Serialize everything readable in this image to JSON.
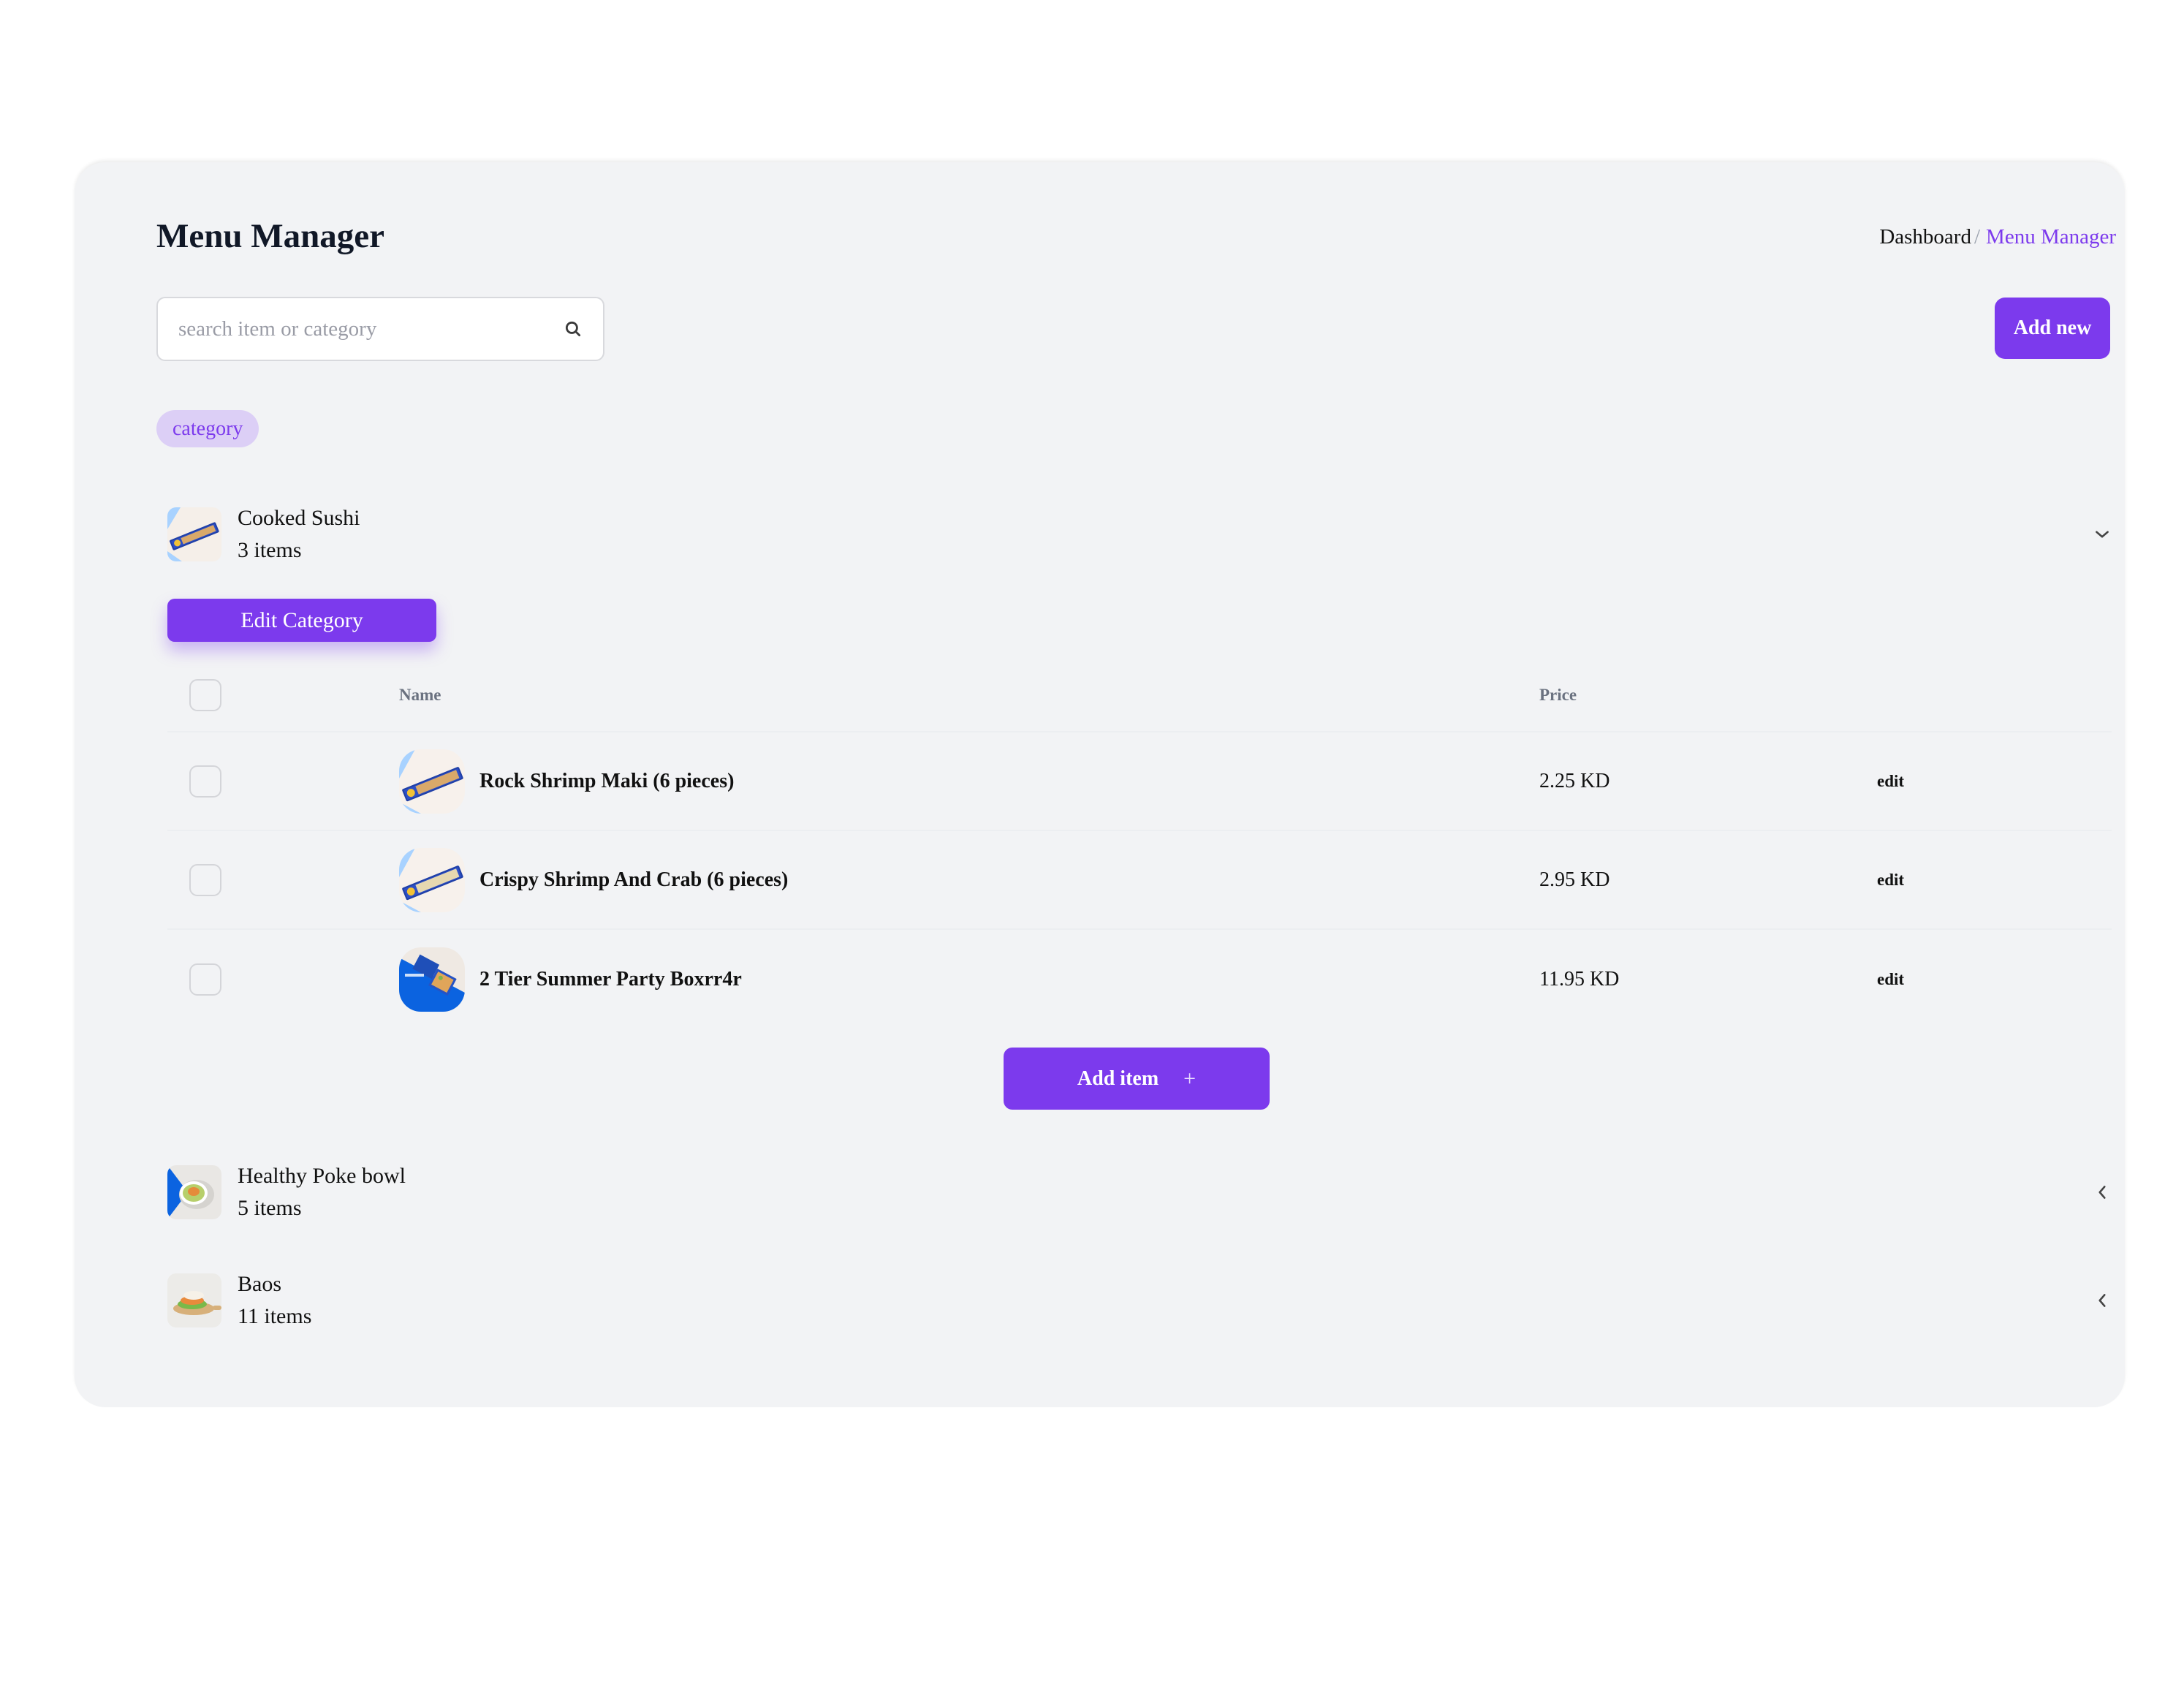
{
  "page": {
    "title": "Menu Manager",
    "breadcrumb": {
      "home": "Dashboard",
      "separator": "/",
      "current": "Menu Manager"
    }
  },
  "toolbar": {
    "search_placeholder": "search item or category",
    "search_value": "",
    "search_icon": "search-icon",
    "add_new_label": "Add new"
  },
  "filter": {
    "chip_label": "category"
  },
  "colors": {
    "accent": "#7c3aed",
    "chip_bg": "#dccff6",
    "card_bg": "#f2f3f5",
    "header_text": "#6b7280"
  },
  "categories": [
    {
      "name": "Cooked Sushi",
      "count": "3 items",
      "expanded": true,
      "chevron": "chevron-down-icon",
      "thumbnail": "sushi-tray-image",
      "edit_label": "Edit Category",
      "table": {
        "columns": [
          "Name",
          "Price"
        ],
        "rows": [
          {
            "name": "Rock Shrimp Maki (6 pieces)",
            "price": "2.25 KD",
            "action": "edit",
            "thumbnail": "sushi-tray-image",
            "checked": false
          },
          {
            "name": "Crispy Shrimp And Crab (6 pieces)",
            "price": "2.95 KD",
            "action": "edit",
            "thumbnail": "sushi-tray-image",
            "checked": false
          },
          {
            "name": "2 Tier Summer Party Boxrr4r",
            "price": "11.95 KD",
            "action": "edit",
            "thumbnail": "party-box-image",
            "checked": false
          }
        ]
      },
      "add_item_label": "Add item",
      "add_item_icon": "+"
    },
    {
      "name": "Healthy Poke bowl",
      "count": "5 items",
      "expanded": false,
      "chevron": "chevron-left-icon",
      "thumbnail": "poke-bowl-image"
    },
    {
      "name": "Baos",
      "count": "11 items",
      "expanded": false,
      "chevron": "chevron-left-icon",
      "thumbnail": "bao-image"
    }
  ]
}
